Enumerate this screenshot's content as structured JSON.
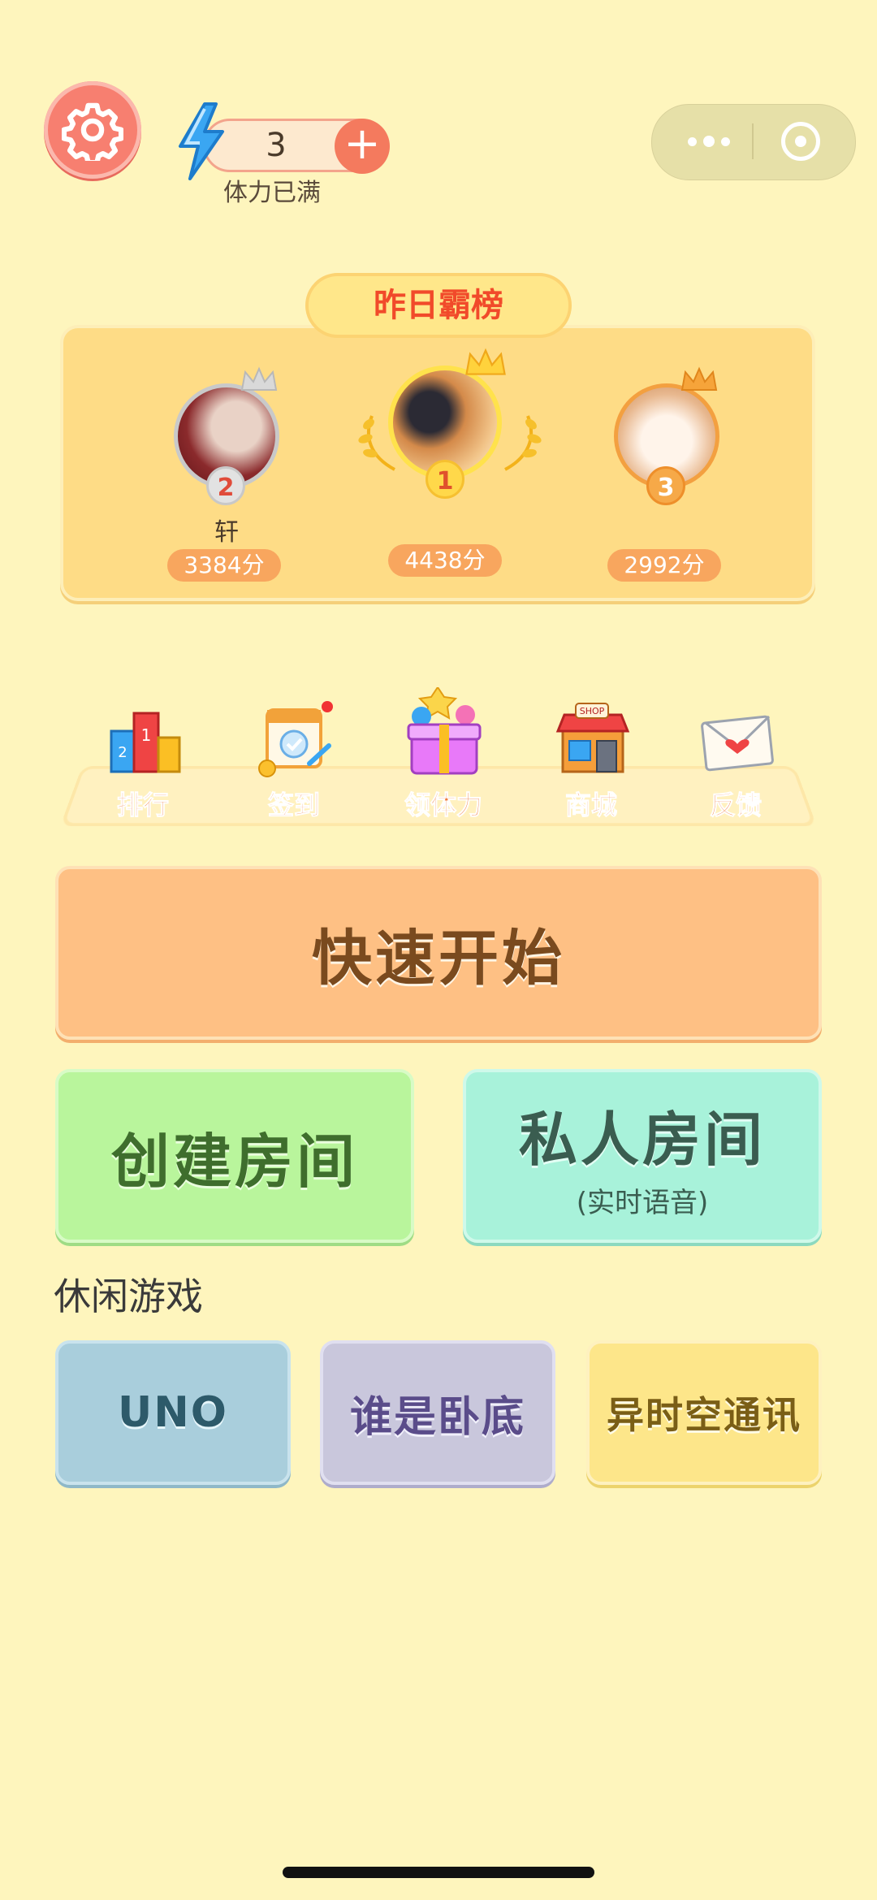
{
  "header": {
    "energy_value": "3",
    "energy_status": "体力已满",
    "plus_label": "+"
  },
  "leaderboard": {
    "title": "昨日霸榜",
    "entries": [
      {
        "rank": "2",
        "name": "轩",
        "score": "3384分"
      },
      {
        "rank": "1",
        "name": "",
        "score": "4438分"
      },
      {
        "rank": "3",
        "name": "",
        "score": "2992分"
      }
    ]
  },
  "features": [
    {
      "label": "排行",
      "icon": "ranking-icon"
    },
    {
      "label": "签到",
      "icon": "calendar-icon",
      "has_dot": true
    },
    {
      "label": "领体力",
      "icon": "gift-icon"
    },
    {
      "label": "商城",
      "icon": "shop-icon"
    },
    {
      "label": "反馈",
      "icon": "envelope-icon"
    }
  ],
  "buttons": {
    "quick_start": "快速开始",
    "create_room": "创建房间",
    "private_room": "私人房间",
    "private_room_sub": "(实时语音)"
  },
  "casual": {
    "title": "休闲游戏",
    "games": [
      "UNO",
      "谁是卧底",
      "异时空通讯"
    ]
  },
  "colors": {
    "background": "#fef5bd",
    "accent_red": "#f14a2a",
    "quick_start": "#fec084",
    "create_room": "#b9f59c",
    "private_room": "#a8f2da"
  }
}
